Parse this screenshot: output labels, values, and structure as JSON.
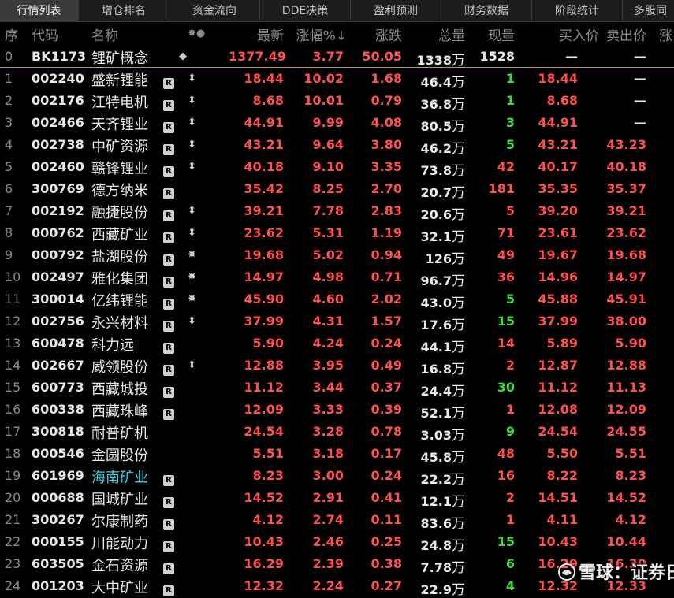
{
  "tabs": [
    "行情列表",
    "增仓排名",
    "资金流向",
    "DDE决策",
    "盈利预测",
    "财务数据",
    "阶段统计",
    "多股同"
  ],
  "header": {
    "seq": "序",
    "code": "代码",
    "name": "名称",
    "marks": "✸●",
    "price": "最新",
    "pct": "涨幅%↓",
    "chg": "涨跌",
    "vol": "总量",
    "cur": "现量",
    "bid": "买入价",
    "ask": "卖出价",
    "extra": "涨"
  },
  "unit_wan": "万",
  "r_badge": "R",
  "colors": {
    "red": "#ff5050",
    "green": "#3ddc3d",
    "cyan": "#3ad5e0",
    "tab_active": "#3a3a3a"
  },
  "rows": [
    {
      "seq": "0",
      "code": "BK1173",
      "name": "锂矿概念",
      "r": false,
      "mark": "◆",
      "price": "1377.49",
      "pct": "3.77",
      "chg": "50.05",
      "vol": "1338",
      "cur": "1528",
      "cur_color": "white",
      "bid": "—",
      "ask": "—"
    },
    {
      "seq": "1",
      "code": "002240",
      "name": "盛新锂能",
      "r": true,
      "mark": "⬍",
      "price": "18.44",
      "pct": "10.02",
      "chg": "1.68",
      "vol": "46.4",
      "cur": "1",
      "cur_color": "green",
      "bid": "18.44",
      "ask": "—"
    },
    {
      "seq": "2",
      "code": "002176",
      "name": "江特电机",
      "r": true,
      "mark": "⬍",
      "price": "8.68",
      "pct": "10.01",
      "chg": "0.79",
      "vol": "36.8",
      "cur": "1",
      "cur_color": "green",
      "bid": "8.68",
      "ask": "—"
    },
    {
      "seq": "3",
      "code": "002466",
      "name": "天齐锂业",
      "r": true,
      "mark": "⬍",
      "price": "44.91",
      "pct": "9.99",
      "chg": "4.08",
      "vol": "80.5",
      "cur": "3",
      "cur_color": "green",
      "bid": "44.91",
      "ask": "—"
    },
    {
      "seq": "4",
      "code": "002738",
      "name": "中矿资源",
      "r": true,
      "mark": "⬍",
      "price": "43.21",
      "pct": "9.64",
      "chg": "3.80",
      "vol": "46.2",
      "cur": "5",
      "cur_color": "green",
      "bid": "43.21",
      "ask": "43.23"
    },
    {
      "seq": "5",
      "code": "002460",
      "name": "赣锋锂业",
      "r": true,
      "mark": "⬍",
      "price": "40.18",
      "pct": "9.10",
      "chg": "3.35",
      "vol": "73.8",
      "cur": "42",
      "cur_color": "red",
      "bid": "40.17",
      "ask": "40.18"
    },
    {
      "seq": "6",
      "code": "300769",
      "name": "德方纳米",
      "r": true,
      "mark": "",
      "price": "35.42",
      "pct": "8.25",
      "chg": "2.70",
      "vol": "20.7",
      "cur": "181",
      "cur_color": "red",
      "bid": "35.35",
      "ask": "35.37"
    },
    {
      "seq": "7",
      "code": "002192",
      "name": "融捷股份",
      "r": true,
      "mark": "⬍",
      "price": "39.21",
      "pct": "7.78",
      "chg": "2.83",
      "vol": "20.6",
      "cur": "5",
      "cur_color": "red",
      "bid": "39.20",
      "ask": "39.21"
    },
    {
      "seq": "8",
      "code": "000762",
      "name": "西藏矿业",
      "r": true,
      "mark": "⬍",
      "price": "23.62",
      "pct": "5.31",
      "chg": "1.19",
      "vol": "32.1",
      "cur": "71",
      "cur_color": "red",
      "bid": "23.61",
      "ask": "23.62"
    },
    {
      "seq": "9",
      "code": "000792",
      "name": "盐湖股份",
      "r": true,
      "mark": "✸",
      "price": "19.68",
      "pct": "5.02",
      "chg": "0.94",
      "vol": "126",
      "cur": "49",
      "cur_color": "red",
      "bid": "19.67",
      "ask": "19.68"
    },
    {
      "seq": "10",
      "code": "002497",
      "name": "雅化集团",
      "r": true,
      "mark": "✸",
      "price": "14.97",
      "pct": "4.98",
      "chg": "0.71",
      "vol": "96.7",
      "cur": "36",
      "cur_color": "red",
      "bid": "14.96",
      "ask": "14.97"
    },
    {
      "seq": "11",
      "code": "300014",
      "name": "亿纬锂能",
      "r": true,
      "mark": "✸",
      "price": "45.90",
      "pct": "4.60",
      "chg": "2.02",
      "vol": "43.0",
      "cur": "5",
      "cur_color": "green",
      "bid": "45.88",
      "ask": "45.91"
    },
    {
      "seq": "12",
      "code": "002756",
      "name": "永兴材料",
      "r": true,
      "mark": "⬍",
      "price": "37.99",
      "pct": "4.31",
      "chg": "1.57",
      "vol": "17.6",
      "cur": "15",
      "cur_color": "green",
      "bid": "37.99",
      "ask": "38.00"
    },
    {
      "seq": "13",
      "code": "600478",
      "name": "科力远",
      "r": true,
      "mark": "",
      "price": "5.90",
      "pct": "4.24",
      "chg": "0.24",
      "vol": "44.1",
      "cur": "14",
      "cur_color": "red",
      "bid": "5.89",
      "ask": "5.90"
    },
    {
      "seq": "14",
      "code": "002667",
      "name": "威领股份",
      "r": true,
      "mark": "⬍",
      "price": "12.88",
      "pct": "3.95",
      "chg": "0.49",
      "vol": "16.8",
      "cur": "2",
      "cur_color": "red",
      "bid": "12.87",
      "ask": "12.88"
    },
    {
      "seq": "15",
      "code": "600773",
      "name": "西藏城投",
      "r": true,
      "mark": "",
      "price": "11.12",
      "pct": "3.44",
      "chg": "0.37",
      "vol": "24.4",
      "cur": "30",
      "cur_color": "green",
      "bid": "11.12",
      "ask": "11.13"
    },
    {
      "seq": "16",
      "code": "600338",
      "name": "西藏珠峰",
      "r": true,
      "mark": "",
      "price": "12.09",
      "pct": "3.33",
      "chg": "0.39",
      "vol": "52.1",
      "cur": "1",
      "cur_color": "red",
      "bid": "12.08",
      "ask": "12.09"
    },
    {
      "seq": "17",
      "code": "300818",
      "name": "耐普矿机",
      "r": false,
      "mark": "",
      "price": "24.54",
      "pct": "3.28",
      "chg": "0.78",
      "vol": "3.03",
      "cur": "9",
      "cur_color": "green",
      "bid": "24.54",
      "ask": "24.55"
    },
    {
      "seq": "18",
      "code": "000546",
      "name": "金圆股份",
      "r": false,
      "mark": "",
      "price": "5.51",
      "pct": "3.18",
      "chg": "0.17",
      "vol": "45.8",
      "cur": "48",
      "cur_color": "red",
      "bid": "5.50",
      "ask": "5.51"
    },
    {
      "seq": "19",
      "code": "601969",
      "name": "海南矿业",
      "r": true,
      "mark": "",
      "price": "8.23",
      "pct": "3.00",
      "chg": "0.24",
      "vol": "22.2",
      "cur": "16",
      "cur_color": "red",
      "bid": "8.22",
      "ask": "8.23",
      "name_color": "cyan"
    },
    {
      "seq": "20",
      "code": "000688",
      "name": "国城矿业",
      "r": true,
      "mark": "",
      "price": "14.52",
      "pct": "2.91",
      "chg": "0.41",
      "vol": "12.1",
      "cur": "2",
      "cur_color": "red",
      "bid": "14.51",
      "ask": "14.52"
    },
    {
      "seq": "21",
      "code": "300267",
      "name": "尔康制药",
      "r": true,
      "mark": "",
      "price": "4.12",
      "pct": "2.74",
      "chg": "0.11",
      "vol": "83.6",
      "cur": "1",
      "cur_color": "red",
      "bid": "4.11",
      "ask": "4.12"
    },
    {
      "seq": "22",
      "code": "000155",
      "name": "川能动力",
      "r": true,
      "mark": "",
      "price": "10.43",
      "pct": "2.46",
      "chg": "0.25",
      "vol": "24.8",
      "cur": "15",
      "cur_color": "green",
      "bid": "10.43",
      "ask": "10.44"
    },
    {
      "seq": "23",
      "code": "603505",
      "name": "金石资源",
      "r": true,
      "mark": "",
      "price": "16.29",
      "pct": "2.39",
      "chg": "0.38",
      "vol": "7.78",
      "cur": "6",
      "cur_color": "green",
      "bid": "16.29",
      "ask": "16.30"
    },
    {
      "seq": "24",
      "code": "001203",
      "name": "大中矿业",
      "r": true,
      "mark": "",
      "price": "12.32",
      "pct": "2.24",
      "chg": "0.27",
      "vol": "22.9",
      "cur": "4",
      "cur_color": "green",
      "bid": "12.32",
      "ask": "12.33"
    }
  ],
  "watermark": "雪球：证券日报"
}
